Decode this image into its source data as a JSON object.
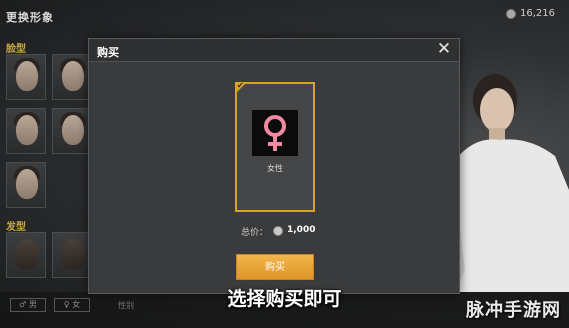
{
  "screen": {
    "title": "更换形象",
    "coins": "16,216"
  },
  "left_panel": {
    "face_section": "脸型",
    "hair_section": "发型"
  },
  "bottom_bar": {
    "male_label": "男",
    "female_label": "女",
    "hint": "性别"
  },
  "modal": {
    "title": "购买",
    "close_symbol": "✕",
    "item": {
      "name": "女性",
      "selected": true
    },
    "price_label": "总价：",
    "price_value": "1,000",
    "buy_label": "购买"
  },
  "caption": "选择购买即可",
  "watermark": "脉冲手游网",
  "colors": {
    "accent": "#e0952a",
    "card_border": "#d9a02a",
    "female_symbol": "#f08aa0"
  }
}
